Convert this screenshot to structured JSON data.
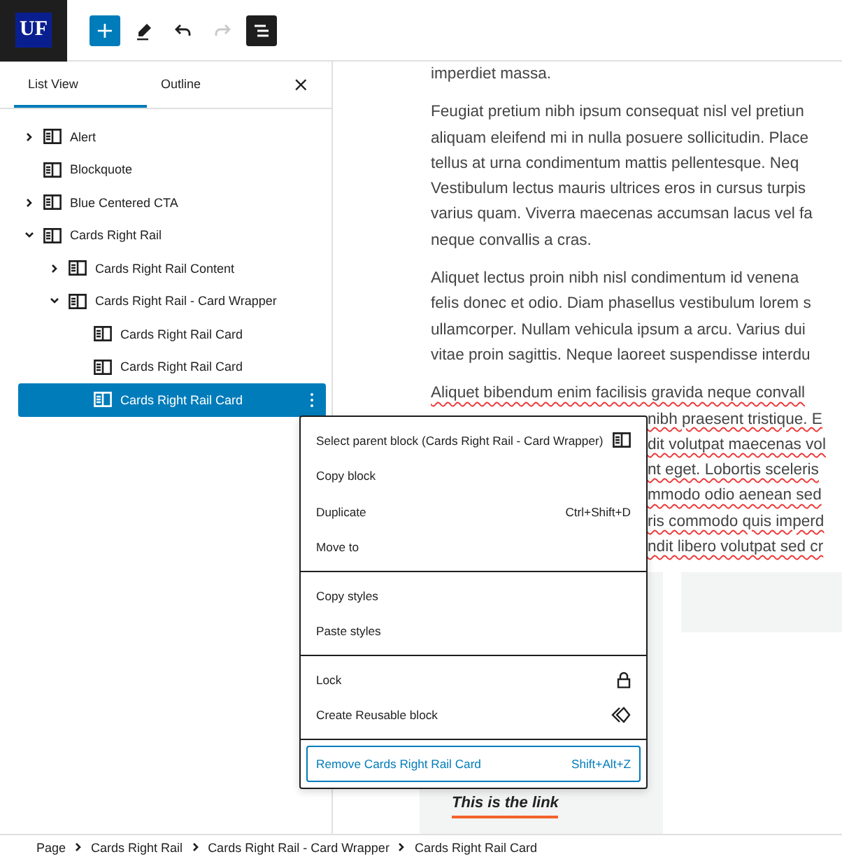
{
  "logo": "UF",
  "toolbar": [
    {
      "kind": "add",
      "label": "+"
    },
    {
      "kind": "edit"
    },
    {
      "kind": "undo",
      "disabled": false
    },
    {
      "kind": "redo",
      "disabled": true
    },
    {
      "kind": "list-view",
      "pressed": true
    }
  ],
  "sidebar": {
    "tabs": [
      {
        "label": "List View",
        "selected": true
      },
      {
        "label": "Outline",
        "selected": false
      }
    ],
    "close": "×",
    "items": [
      {
        "label": "Alert",
        "expanded": false,
        "selected": false
      },
      {
        "label": "Blockquote",
        "selected": false
      },
      {
        "label": "Blue Centered CTA",
        "expanded": false,
        "selected": false
      },
      {
        "label": "Cards Right Rail",
        "expanded": true,
        "selected": false,
        "children": [
          {
            "label": "Cards Right Rail Content",
            "expanded": false,
            "selected": false
          },
          {
            "label": "Cards Right Rail - Card Wrapper",
            "expanded": true,
            "selected": false,
            "children": [
              {
                "label": "Cards Right Rail Card",
                "selected": false
              },
              {
                "label": "Cards Right Rail Card",
                "selected": false
              },
              {
                "label": "Cards Right Rail Card",
                "selected": true
              }
            ]
          }
        ]
      }
    ]
  },
  "content": {
    "paragraphs": [
      {
        "lines": [
          {
            "text": "imperdiet massa.",
            "misspelled": false
          }
        ]
      },
      {
        "lines": [
          {
            "text": "Feugiat pretium nibh ipsum consequat nisl vel pretiun",
            "misspelled": false
          },
          {
            "text": "aliquam eleifend mi in nulla posuere sollicitudin. Place",
            "misspelled": false
          },
          {
            "text": "tellus at urna condimentum mattis pellentesque. Neq",
            "misspelled": false
          },
          {
            "text": "Vestibulum lectus mauris ultrices eros in cursus turpis",
            "misspelled": false
          },
          {
            "text": "varius quam. Viverra maecenas accumsan lacus vel fa",
            "misspelled": false
          },
          {
            "text": "neque convallis a cras.",
            "misspelled": false
          }
        ]
      },
      {
        "lines": [
          {
            "text": "Aliquet lectus proin nibh nisl condimentum id venena",
            "misspelled": false
          },
          {
            "text": "felis donec et odio. Diam phasellus vestibulum lorem s",
            "misspelled": false
          },
          {
            "text": "ullamcorper. Nullam vehicula ipsum a arcu. Varius dui",
            "misspelled": false
          },
          {
            "text": "vitae proin sagittis. Neque laoreet suspendisse interdu",
            "misspelled": false
          }
        ]
      },
      {
        "lines": [
          {
            "text": "Aliquet bibendum enim facilisis gravida neque convall",
            "misspelled": true
          },
          {
            "text": "nibh praesent tristique. E",
            "misspelled": true
          },
          {
            "text": "dit volutpat maecenas vol",
            "misspelled": true
          },
          {
            "text": "nt eget. Lobortis sceleris",
            "misspelled": true
          },
          {
            "text": "mmodo odio aenean sed",
            "misspelled": true
          },
          {
            "text": "ris commodo quis imperd",
            "misspelled": true
          },
          {
            "text": "ndit libero volutpat sed cr",
            "misspelled": true
          }
        ]
      }
    ],
    "card_link": "This is the link"
  },
  "menu": {
    "groups": [
      [
        {
          "label": "Select parent block (Cards Right Rail - Card Wrapper)",
          "focused": false
        },
        {
          "label": "Copy block",
          "focused": false
        },
        {
          "label": "Duplicate",
          "shortcut": "Ctrl+Shift+D",
          "focused": false
        },
        {
          "label": "Move to",
          "focused": false
        }
      ],
      [
        {
          "label": "Copy styles",
          "focused": false
        },
        {
          "label": "Paste styles",
          "focused": false
        }
      ],
      [
        {
          "label": "Lock",
          "focused": false
        },
        {
          "label": "Create Reusable block",
          "focused": false
        }
      ],
      [
        {
          "label": "Remove Cards Right Rail Card",
          "shortcut": "Shift+Alt+Z",
          "focused": true
        }
      ]
    ]
  },
  "breadcrumb": [
    "Page",
    "Cards Right Rail",
    "Cards Right Rail - Card Wrapper",
    "Cards Right Rail Card"
  ]
}
